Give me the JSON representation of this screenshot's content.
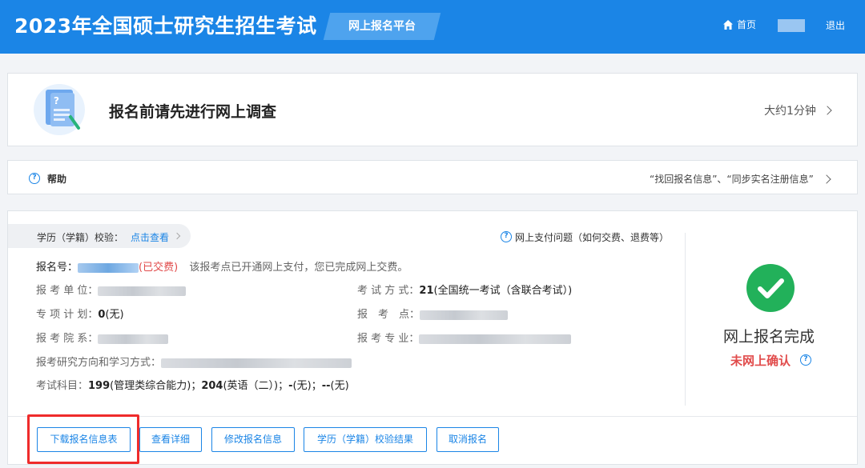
{
  "header": {
    "site_title": "2023年全国硕士研究生招生考试",
    "platform": "网上报名平台",
    "home": "首页",
    "logout": "退出"
  },
  "survey": {
    "title": "报名前请先进行网上调查",
    "duration": "大约1分钟"
  },
  "help": {
    "label": "帮助",
    "links": "“找回报名信息”、“同步实名注册信息”"
  },
  "registration": {
    "verify_label": "学历（学籍）校验：",
    "verify_link": "点击查看",
    "payment_help": "网上支付问题（如何交费、退费等）",
    "reg_no_label": "报名号：",
    "paid_status": "(已交费)",
    "paid_note": "该报考点已开通网上支付，您已完成网上交费。",
    "unit_label": "报 考 单 位：",
    "exam_mode_label": "考 试 方 式：",
    "exam_mode_code": "21",
    "exam_mode_value": "(全国统一考试（含联合考试）)",
    "special_plan_label": "专 项 计 划：",
    "special_plan_code": "0",
    "special_plan_value": "(无)",
    "site_label": "报　考　点：",
    "dept_label": "报 考 院 系：",
    "major_label": "报 考 专 业：",
    "direction_label": "报考研究方向和学习方式：",
    "subjects_label": "考试科目：",
    "subjects": [
      {
        "code": "199",
        "name": "(管理类综合能力)"
      },
      {
        "code": "204",
        "name": "(英语（二）)"
      },
      {
        "code": "-",
        "name": "(无)"
      },
      {
        "code": "--",
        "name": "(无)"
      }
    ]
  },
  "status": {
    "completed": "网上报名完成",
    "unconfirmed": "未网上确认"
  },
  "buttons": {
    "download": "下载报名信息表",
    "details": "查看详细",
    "modify": "修改报名信息",
    "verify_result": "学历（学籍）校验结果",
    "cancel": "取消报名"
  },
  "colors": {
    "primary": "#1b85e6",
    "success": "#22b15a",
    "warning_red": "#e14b4b",
    "highlight_red": "#ef2b2b"
  }
}
